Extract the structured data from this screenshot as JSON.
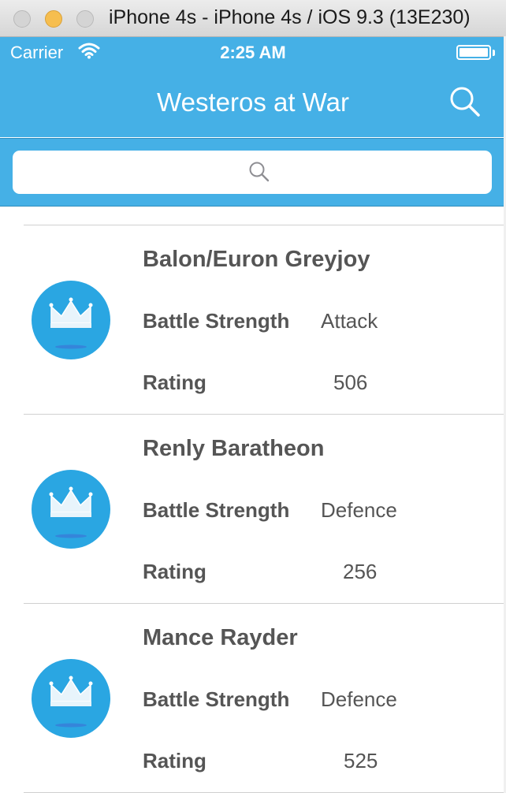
{
  "window": {
    "title": "iPhone 4s - iPhone 4s / iOS 9.3 (13E230)"
  },
  "status_bar": {
    "carrier": "Carrier",
    "time": "2:25 AM"
  },
  "nav": {
    "title": "Westeros at War",
    "search_icon": "search-icon"
  },
  "search": {
    "placeholder": "",
    "icon": "search-icon"
  },
  "list": {
    "labels": {
      "battle_strength": "Battle Strength",
      "rating": "Rating"
    },
    "items": [
      {
        "name": "Balon/Euron Greyjoy",
        "battle_strength": "Attack",
        "rating": "506",
        "avatar_icon": "crown-icon"
      },
      {
        "name": "Renly Baratheon",
        "battle_strength": "Defence",
        "rating": "256",
        "avatar_icon": "crown-icon"
      },
      {
        "name": "Mance Rayder",
        "battle_strength": "Defence",
        "rating": "525",
        "avatar_icon": "crown-icon"
      }
    ]
  },
  "colors": {
    "accent": "#45b0e6",
    "avatar": "#2aa6e2",
    "text": "#555555"
  }
}
